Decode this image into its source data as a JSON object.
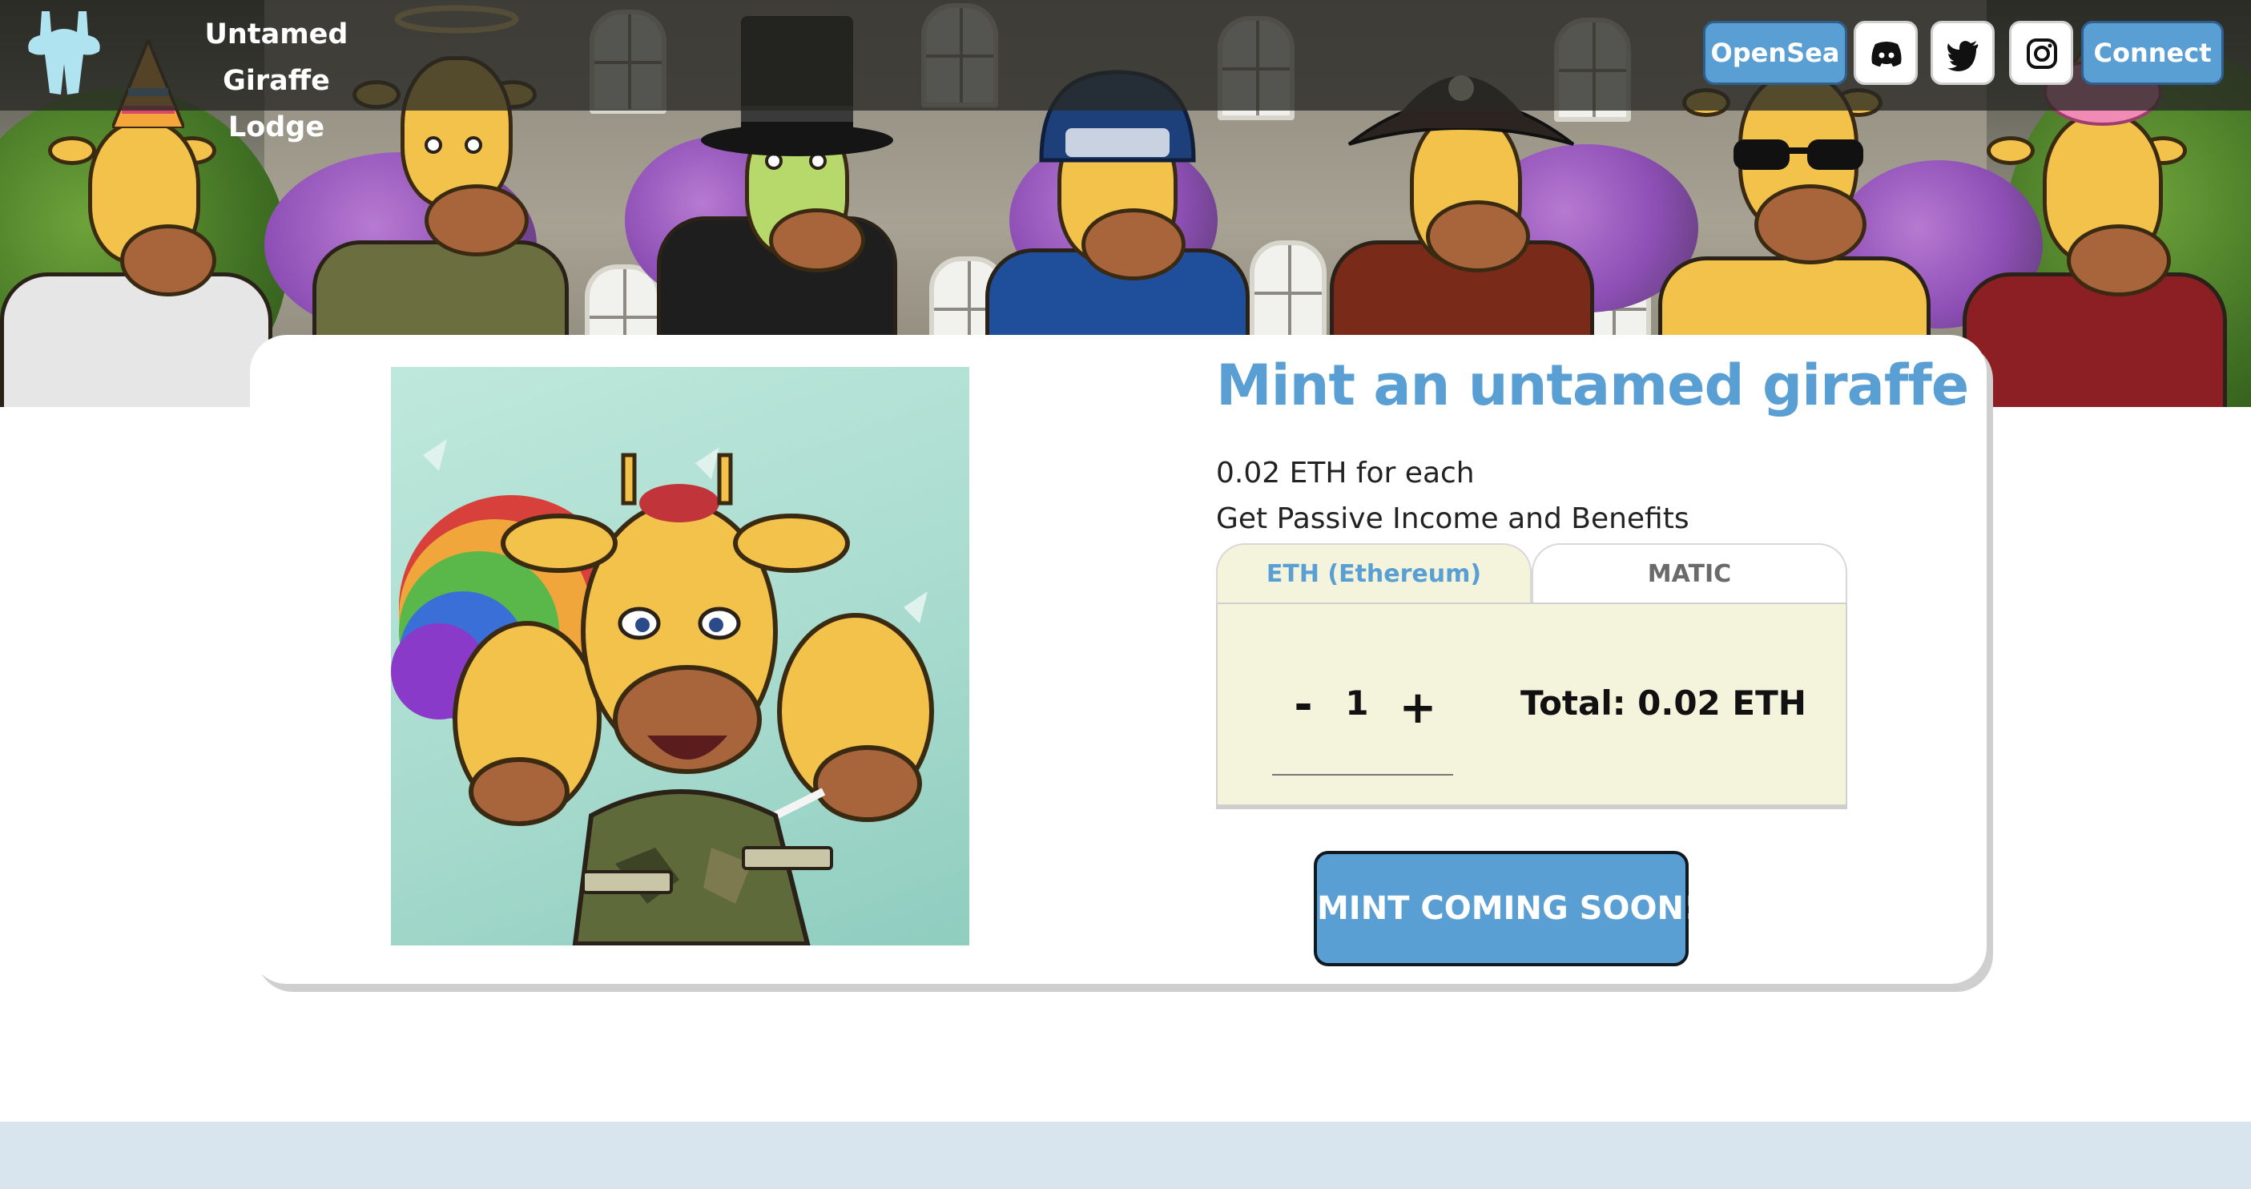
{
  "header": {
    "brand_line1": "Untamed Giraffe",
    "brand_line2": "Lodge",
    "logo_icon": "giraffe-head-logo",
    "opensea_label": "OpenSea",
    "discord_icon": "discord-icon",
    "twitter_icon": "twitter-icon",
    "instagram_icon": "instagram-icon",
    "connect_label": "Connect"
  },
  "mint": {
    "title": "Mint an untamed giraffe",
    "price_text": "0.02 ETH for each",
    "benefit_text": "Get Passive Income and Benefits",
    "tabs": [
      {
        "label": "ETH (Ethereum)",
        "active": true
      },
      {
        "label": "MATIC",
        "active": false
      }
    ],
    "quantity": {
      "minus_label": "-",
      "value": "1",
      "plus_label": "+"
    },
    "total_text": "Total: 0.02 ETH",
    "button_label": "MINT COMING SOON!"
  },
  "colors": {
    "accent": "#5a9fd4",
    "panel": "#f4f3db",
    "footer": "#d8e4ee",
    "topbar": "#28282a"
  }
}
